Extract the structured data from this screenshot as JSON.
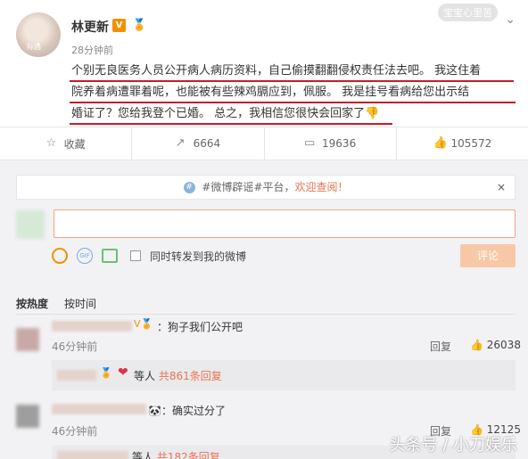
{
  "post": {
    "username": "林更新",
    "verified_badge": "V",
    "medal_icon": "medal-icon",
    "time": "28分钟前",
    "avatar_caption": "际遇",
    "top_watermark": "宝宝心里苦",
    "content_lines": [
      "个别无良医务人员公开病人病历资料，自己偷摸翻翻侵权责任法去吧。 我这住着",
      "院养着病遭罪着呢，也能被有些辣鸡膈应到，佩服。 我是挂号看病给您出示结",
      "婚证了？您给我登个已婚。 总之，我相信您很快会回家了👎"
    ]
  },
  "actions": {
    "favorite": {
      "icon": "star-icon",
      "label": "收藏"
    },
    "repost": {
      "icon": "repost-icon",
      "label": "6664"
    },
    "comment": {
      "icon": "comment-icon",
      "label": "19636"
    },
    "like": {
      "icon": "thumbs-up-icon",
      "label": "105572"
    }
  },
  "notice": {
    "tag": "#微博辟谣#平台，",
    "link": "欢迎查阅！",
    "close": "×"
  },
  "composer": {
    "repost_checkbox_label": "同时转发到我的微博",
    "send_label": "评论"
  },
  "sort": {
    "hot": "按热度",
    "time": "按时间"
  },
  "comments": [
    {
      "text": "：狗子我们公开吧",
      "time": "46分钟前",
      "reply": "回复",
      "likes": "26038",
      "sub_count_prefix": "等人",
      "sub_count": "共861条回复"
    },
    {
      "text": "🐼：确实过分了",
      "time": "46分钟前",
      "reply": "回复",
      "likes": "12125",
      "sub_count_prefix": "等人",
      "sub_count": "共182条回复"
    }
  ],
  "watermark": "头条号 / 小刀娱乐"
}
